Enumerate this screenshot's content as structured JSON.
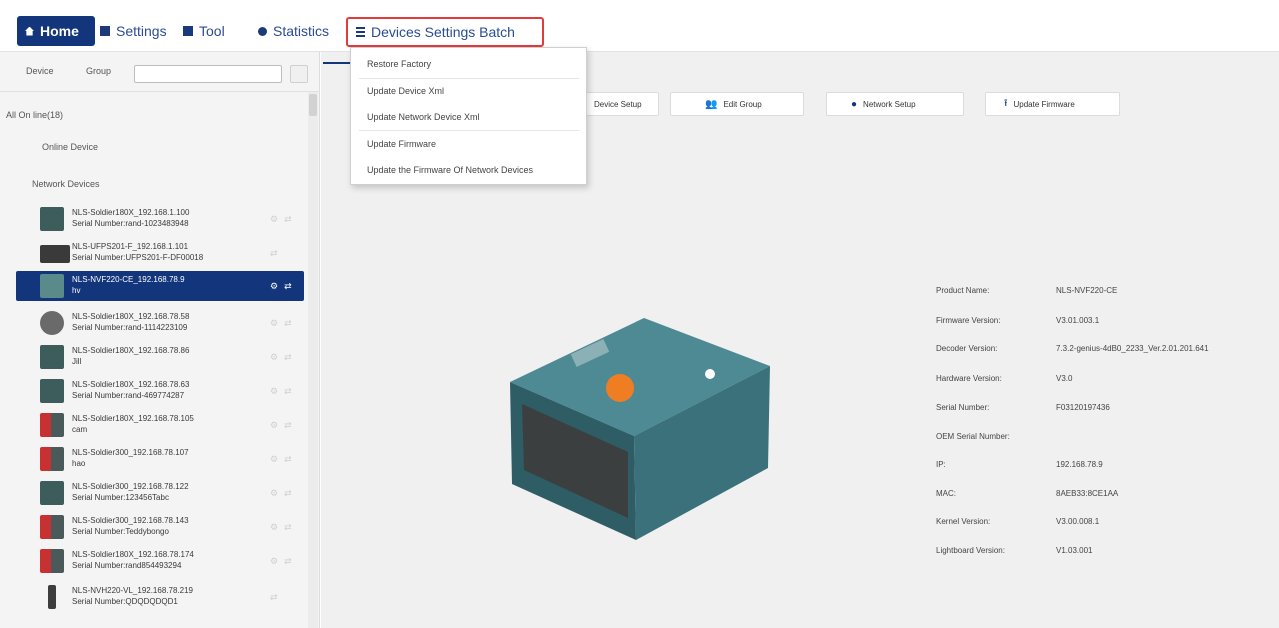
{
  "menu": {
    "home": "Home",
    "settings": "Settings",
    "tool": "Tool",
    "statistics": "Statistics",
    "batch": "Devices Settings Batch"
  },
  "dropdown": {
    "items": [
      "Restore Factory",
      "Update Device Xml",
      "Update Network Device Xml",
      "Update Firmware",
      "Update the Firmware Of Network Devices"
    ]
  },
  "left": {
    "tab_device": "Device",
    "tab_group": "Group",
    "search_placeholder": "",
    "all_on_line": "All On line(18)",
    "online_device": "Online Device",
    "network_devices": "Network Devices",
    "devices": [
      {
        "line1": "NLS-Soldier180X_192.168.1.100",
        "line2": "Serial Number:rand-1023483948"
      },
      {
        "line1": "NLS-UFPS201-F_192.168.1.101",
        "line2": "Serial Number:UFPS201-F-DF00018"
      },
      {
        "line1": "NLS-NVF220-CE_192.168.78.9",
        "line2": "hv"
      },
      {
        "line1": "NLS-Soldier180X_192.168.78.58",
        "line2": "Serial Number:rand-1114223109"
      },
      {
        "line1": "NLS-Soldier180X_192.168.78.86",
        "line2": "Jill"
      },
      {
        "line1": "NLS-Soldier180X_192.168.78.63",
        "line2": "Serial Number:rand-469774287"
      },
      {
        "line1": "NLS-Soldier180X_192.168.78.105",
        "line2": "cam"
      },
      {
        "line1": "NLS-Soldier300_192.168.78.107",
        "line2": "hao"
      },
      {
        "line1": "NLS-Soldier300_192.168.78.122",
        "line2": "Serial Number:123456Tabc"
      },
      {
        "line1": "NLS-Soldier300_192.168.78.143",
        "line2": "Serial Number:Teddybongo"
      },
      {
        "line1": "NLS-Soldier180X_192.168.78.174",
        "line2": "Serial Number:rand854493294"
      },
      {
        "line1": "NLS-NVH220-VL_192.168.78.219",
        "line2": "Serial Number:QDQDQDQD1"
      }
    ]
  },
  "main": {
    "buttons": {
      "device_setup": "Device Setup",
      "edit_group": "Edit Group",
      "network_setup": "Network Setup",
      "update_firmware": "Update Firmware"
    },
    "info": [
      {
        "label": "Product Name:",
        "value": "NLS-NVF220-CE"
      },
      {
        "label": "Firmware Version:",
        "value": "V3.01.003.1"
      },
      {
        "label": "Decoder Version:",
        "value": "7.3.2-genius-4dB0_2233_Ver.2.01.201.641"
      },
      {
        "label": "Hardware Version:",
        "value": "V3.0"
      },
      {
        "label": "Serial Number:",
        "value": "F03120197436"
      },
      {
        "label": "OEM Serial Number:",
        "value": ""
      },
      {
        "label": "IP:",
        "value": "192.168.78.9"
      },
      {
        "label": "MAC:",
        "value": "8AEB33:8CE1AA"
      },
      {
        "label": "Kernel Version:",
        "value": "V3.00.008.1"
      },
      {
        "label": "Lightboard Version:",
        "value": "V1.03.001"
      }
    ]
  },
  "colors": {
    "accent": "#12357c",
    "highlight_border": "#e23b3b",
    "device_body": "#3a6e77"
  }
}
